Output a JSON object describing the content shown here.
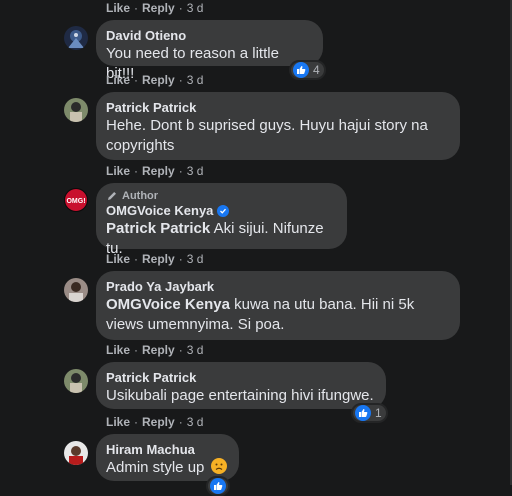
{
  "actions": {
    "like": "Like",
    "reply": "Reply",
    "sep": "·"
  },
  "top_actions": {
    "time": "3 d"
  },
  "comments": [
    {
      "author": "David Otieno",
      "text": "You need to reason a little bit!!!",
      "reactions": "4",
      "time": "3 d"
    },
    {
      "author": "Patrick Patrick",
      "text": "Hehe. Dont b suprised guys. Huyu hajui story na copyrights",
      "time": "3 d"
    },
    {
      "author_tag": "Author",
      "author": "OMGVoice Kenya",
      "mention": "Patrick Patrick",
      "text": " Aki sijui. Nifunze tu.",
      "time": "3 d"
    },
    {
      "author": "Prado Ya Jaybark",
      "mention": "OMGVoice Kenya",
      "text": " kuwa na utu bana. Hii ni 5k views umemnyima. Si poa.",
      "time": "3 d"
    },
    {
      "author": "Patrick Patrick",
      "text": "Usikubali page entertaining hivi ifungwe.",
      "reactions": "1",
      "time": "3 d"
    },
    {
      "author": "Hiram Machua",
      "text": "Admin style up",
      "emoji": "disappointed-face"
    }
  ],
  "avatar_logo_text": "OMG!",
  "colors": {
    "background": "#18191a",
    "bubble": "#3a3b3c",
    "text": "#e4e6eb",
    "muted": "#b0b3b8",
    "like_blue": "#1877f2"
  }
}
